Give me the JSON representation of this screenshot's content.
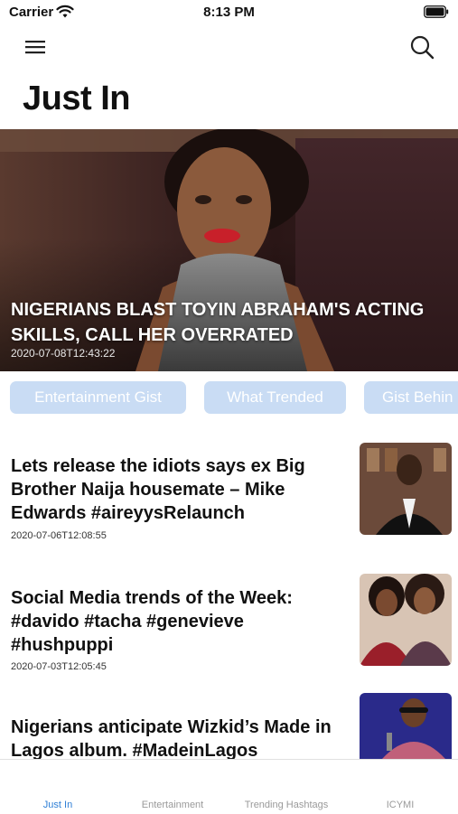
{
  "status_bar": {
    "carrier": "Carrier",
    "time": "8:13 PM"
  },
  "nav": {
    "title": "Just In",
    "menu_icon": "hamburger-menu-icon",
    "search_icon": "search-icon"
  },
  "hero": {
    "headline": "NIGERIANS BLAST TOYIN ABRAHAM'S ACTING SKILLS, CALL HER OVERRATED",
    "date": "2020-07-08T12:43:22"
  },
  "categories": [
    {
      "label": "Entertainment Gist"
    },
    {
      "label": "What Trended"
    },
    {
      "label": "Gist Behin"
    }
  ],
  "articles": [
    {
      "title": "Lets release the idiots says ex Big Brother Naija housemate – Mike Edwards #aireyysRelaunch",
      "date": "2020-07-06T12:08:55"
    },
    {
      "title": "Social Media trends of the Week: #davido #tacha #genevieve #hushpuppi",
      "date": "2020-07-03T12:05:45"
    },
    {
      "title": "Nigerians anticipate Wizkid’s Made in Lagos album. #MadeinLagos",
      "date": ""
    }
  ],
  "tabbar": {
    "tabs": [
      {
        "label": "Just In",
        "active": true
      },
      {
        "label": "Entertainment",
        "active": false
      },
      {
        "label": "Trending Hashtags",
        "active": false
      },
      {
        "label": "ICYMI",
        "active": false
      }
    ]
  },
  "colors": {
    "accent": "#2f7fd6",
    "pill_bg": "#c9dcf4",
    "tab_inactive": "#9a9a9a"
  }
}
